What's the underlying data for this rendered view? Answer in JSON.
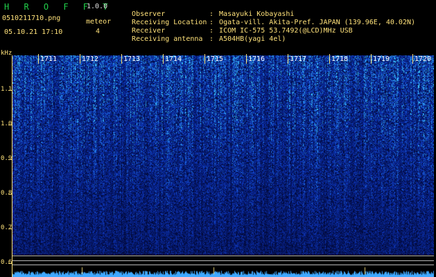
{
  "app": {
    "brand": "H R O F F T",
    "version": "1.0.0"
  },
  "file": {
    "name": "0510211710.png",
    "timestamp": "05.10.21 17:10"
  },
  "meteor": {
    "label": "meteor",
    "count": "4"
  },
  "info": [
    {
      "label": "Observer",
      "value": "Masayuki Kobayashi"
    },
    {
      "label": "Receiving Location",
      "value": "Ogata-vill. Akita-Pref. JAPAN (139.96E, 40.02N)"
    },
    {
      "label": "Receiver",
      "value": "ICOM IC-575 53.7492(@LCD)MHz USB"
    },
    {
      "label": "Receiving antenna",
      "value": "A504HB(yagi 4el)"
    }
  ],
  "axis": {
    "unit": "kHz",
    "freq_labels": [
      "1.1",
      "1.0",
      "0.9",
      "0.8",
      "0.7",
      "0.6"
    ],
    "time_labels": [
      "1711",
      "1712",
      "1713",
      "1714",
      "1715",
      "1716",
      "1717",
      "1718",
      "1719",
      "1720"
    ]
  },
  "colors": {
    "accent_green": "#21d04a",
    "label_yellow": "#ffe27a",
    "background": "#000000",
    "spectrum_base": "#061a6e"
  }
}
